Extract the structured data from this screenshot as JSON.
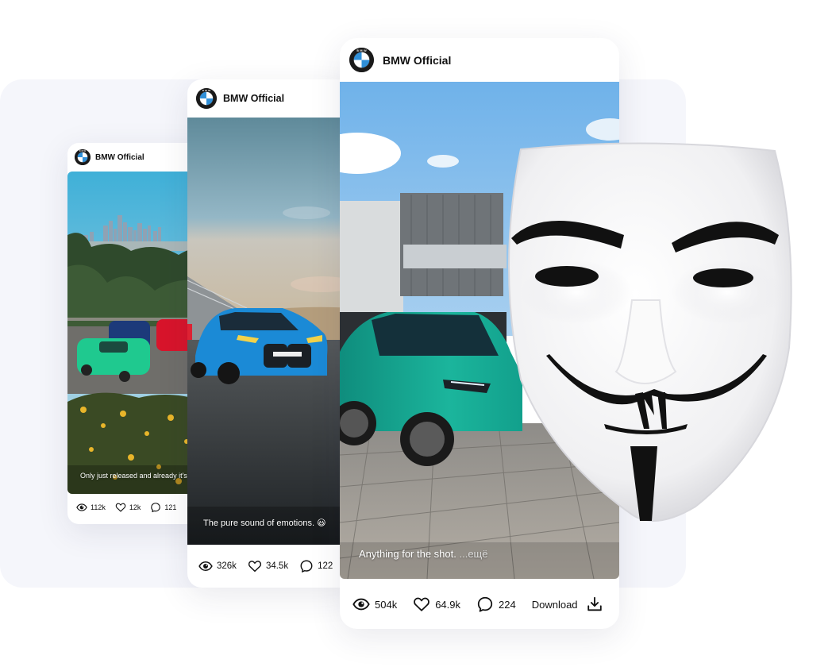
{
  "page": {
    "background_panel_color": "#f5f6fb"
  },
  "posts": [
    {
      "account_name": "BMW Official",
      "caption": "Only just released and already it's doi",
      "caption_more": "",
      "stats": {
        "views": "112k",
        "likes": "12k",
        "comments": "121"
      },
      "photo_description": "LA skyline with green, blue and red BMW SUVs on hillside road"
    },
    {
      "account_name": "BMW Official",
      "caption": "The pure sound of emotions. 😃",
      "caption_more": "",
      "stats": {
        "views": "326k",
        "likes": "34.5k",
        "comments": "122"
      },
      "photo_description": "Blue BMW M4 on race track under cloudy sky"
    },
    {
      "account_name": "BMW Official",
      "caption": "Anything for the shot.",
      "caption_more": "...ещё",
      "stats": {
        "views": "504k",
        "likes": "64.9k",
        "comments": "224"
      },
      "download_label": "Download",
      "photo_description": "Teal BMW X6 parked in front of grey building"
    }
  ],
  "icons": {
    "views": "eye-icon",
    "likes": "heart-icon",
    "comments": "comment-bubble-icon",
    "download": "download-icon",
    "logo": "bmw-logo-icon",
    "mask": "guy-fawkes-mask-icon"
  },
  "colors": {
    "card_bg": "#ffffff",
    "text": "#111111",
    "caption_text": "#ffffff"
  }
}
